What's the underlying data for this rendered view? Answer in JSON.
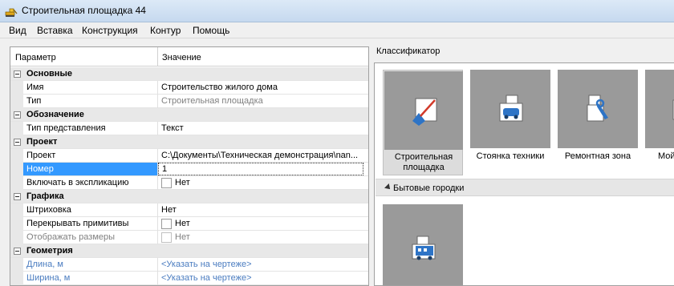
{
  "window": {
    "title": "Строительная площадка 44",
    "icon": "construction-excavator-icon"
  },
  "menu": [
    "Вид",
    "Вставка",
    "Конструкция",
    "Контур",
    "Помощь"
  ],
  "grid": {
    "header": {
      "param": "Параметр",
      "value": "Значение"
    },
    "rows": [
      {
        "type": "category",
        "name": "Основные"
      },
      {
        "type": "prop",
        "name": "Имя",
        "value": "Строительство жилого дома"
      },
      {
        "type": "prop",
        "name": "Тип",
        "value": "Строительная площадка",
        "value_style": "grey"
      },
      {
        "type": "category",
        "name": "Обозначение"
      },
      {
        "type": "prop",
        "name": "Тип представления",
        "value": "Текст"
      },
      {
        "type": "category",
        "name": "Проект"
      },
      {
        "type": "prop",
        "name": "Проект",
        "value": "C:\\Документы\\Техническая демонстрация\\nan..."
      },
      {
        "type": "prop",
        "name": "Номер",
        "value": "1",
        "selected": true
      },
      {
        "type": "check",
        "name": "Включать в экспликацию",
        "value": "Нет"
      },
      {
        "type": "category",
        "name": "Графика"
      },
      {
        "type": "prop",
        "name": "Штриховка",
        "value": "Нет"
      },
      {
        "type": "check",
        "name": "Перекрывать примитивы",
        "value": "Нет"
      },
      {
        "type": "check",
        "name": "Отображать размеры",
        "value": "Нет",
        "disabled": true
      },
      {
        "type": "category",
        "name": "Геометрия"
      },
      {
        "type": "prop",
        "name": "Длина, м",
        "value": "<Указать на чертеже>",
        "name_style": "link",
        "value_style": "link"
      },
      {
        "type": "prop",
        "name": "Ширина, м",
        "value": "<Указать на чертеже>",
        "name_style": "link",
        "value_style": "link"
      }
    ]
  },
  "classifier": {
    "label": "Классификатор",
    "tiles": [
      {
        "label": "Строительная площадка",
        "icon": "construction-site-icon",
        "active": true
      },
      {
        "label": "Стоянка техники",
        "icon": "vehicle-parking-icon"
      },
      {
        "label": "Ремонтная зона",
        "icon": "repair-zone-icon"
      },
      {
        "label": "Мой",
        "icon": "wash-icon"
      }
    ],
    "group": {
      "label": "Бытовые городки",
      "tiles": [
        {
          "label": "",
          "icon": "cabin-trailer-icon"
        }
      ]
    }
  }
}
